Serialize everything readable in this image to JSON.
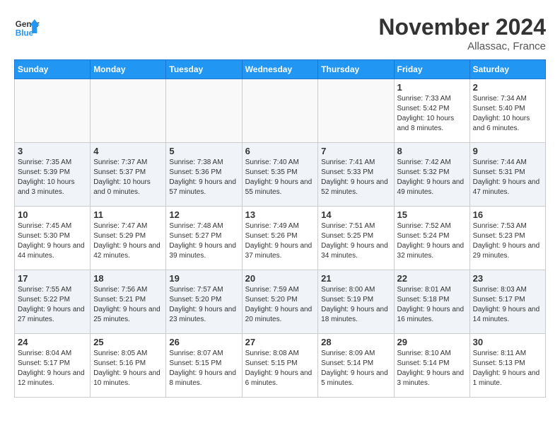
{
  "logo": {
    "text_general": "General",
    "text_blue": "Blue"
  },
  "title": "November 2024",
  "location": "Allassac, France",
  "days_of_week": [
    "Sunday",
    "Monday",
    "Tuesday",
    "Wednesday",
    "Thursday",
    "Friday",
    "Saturday"
  ],
  "weeks": [
    [
      {
        "day": "",
        "empty": true
      },
      {
        "day": "",
        "empty": true
      },
      {
        "day": "",
        "empty": true
      },
      {
        "day": "",
        "empty": true
      },
      {
        "day": "",
        "empty": true
      },
      {
        "day": "1",
        "sunrise": "Sunrise: 7:33 AM",
        "sunset": "Sunset: 5:42 PM",
        "daylight": "Daylight: 10 hours and 8 minutes."
      },
      {
        "day": "2",
        "sunrise": "Sunrise: 7:34 AM",
        "sunset": "Sunset: 5:40 PM",
        "daylight": "Daylight: 10 hours and 6 minutes."
      }
    ],
    [
      {
        "day": "3",
        "sunrise": "Sunrise: 7:35 AM",
        "sunset": "Sunset: 5:39 PM",
        "daylight": "Daylight: 10 hours and 3 minutes."
      },
      {
        "day": "4",
        "sunrise": "Sunrise: 7:37 AM",
        "sunset": "Sunset: 5:37 PM",
        "daylight": "Daylight: 10 hours and 0 minutes."
      },
      {
        "day": "5",
        "sunrise": "Sunrise: 7:38 AM",
        "sunset": "Sunset: 5:36 PM",
        "daylight": "Daylight: 9 hours and 57 minutes."
      },
      {
        "day": "6",
        "sunrise": "Sunrise: 7:40 AM",
        "sunset": "Sunset: 5:35 PM",
        "daylight": "Daylight: 9 hours and 55 minutes."
      },
      {
        "day": "7",
        "sunrise": "Sunrise: 7:41 AM",
        "sunset": "Sunset: 5:33 PM",
        "daylight": "Daylight: 9 hours and 52 minutes."
      },
      {
        "day": "8",
        "sunrise": "Sunrise: 7:42 AM",
        "sunset": "Sunset: 5:32 PM",
        "daylight": "Daylight: 9 hours and 49 minutes."
      },
      {
        "day": "9",
        "sunrise": "Sunrise: 7:44 AM",
        "sunset": "Sunset: 5:31 PM",
        "daylight": "Daylight: 9 hours and 47 minutes."
      }
    ],
    [
      {
        "day": "10",
        "sunrise": "Sunrise: 7:45 AM",
        "sunset": "Sunset: 5:30 PM",
        "daylight": "Daylight: 9 hours and 44 minutes."
      },
      {
        "day": "11",
        "sunrise": "Sunrise: 7:47 AM",
        "sunset": "Sunset: 5:29 PM",
        "daylight": "Daylight: 9 hours and 42 minutes."
      },
      {
        "day": "12",
        "sunrise": "Sunrise: 7:48 AM",
        "sunset": "Sunset: 5:27 PM",
        "daylight": "Daylight: 9 hours and 39 minutes."
      },
      {
        "day": "13",
        "sunrise": "Sunrise: 7:49 AM",
        "sunset": "Sunset: 5:26 PM",
        "daylight": "Daylight: 9 hours and 37 minutes."
      },
      {
        "day": "14",
        "sunrise": "Sunrise: 7:51 AM",
        "sunset": "Sunset: 5:25 PM",
        "daylight": "Daylight: 9 hours and 34 minutes."
      },
      {
        "day": "15",
        "sunrise": "Sunrise: 7:52 AM",
        "sunset": "Sunset: 5:24 PM",
        "daylight": "Daylight: 9 hours and 32 minutes."
      },
      {
        "day": "16",
        "sunrise": "Sunrise: 7:53 AM",
        "sunset": "Sunset: 5:23 PM",
        "daylight": "Daylight: 9 hours and 29 minutes."
      }
    ],
    [
      {
        "day": "17",
        "sunrise": "Sunrise: 7:55 AM",
        "sunset": "Sunset: 5:22 PM",
        "daylight": "Daylight: 9 hours and 27 minutes."
      },
      {
        "day": "18",
        "sunrise": "Sunrise: 7:56 AM",
        "sunset": "Sunset: 5:21 PM",
        "daylight": "Daylight: 9 hours and 25 minutes."
      },
      {
        "day": "19",
        "sunrise": "Sunrise: 7:57 AM",
        "sunset": "Sunset: 5:20 PM",
        "daylight": "Daylight: 9 hours and 23 minutes."
      },
      {
        "day": "20",
        "sunrise": "Sunrise: 7:59 AM",
        "sunset": "Sunset: 5:20 PM",
        "daylight": "Daylight: 9 hours and 20 minutes."
      },
      {
        "day": "21",
        "sunrise": "Sunrise: 8:00 AM",
        "sunset": "Sunset: 5:19 PM",
        "daylight": "Daylight: 9 hours and 18 minutes."
      },
      {
        "day": "22",
        "sunrise": "Sunrise: 8:01 AM",
        "sunset": "Sunset: 5:18 PM",
        "daylight": "Daylight: 9 hours and 16 minutes."
      },
      {
        "day": "23",
        "sunrise": "Sunrise: 8:03 AM",
        "sunset": "Sunset: 5:17 PM",
        "daylight": "Daylight: 9 hours and 14 minutes."
      }
    ],
    [
      {
        "day": "24",
        "sunrise": "Sunrise: 8:04 AM",
        "sunset": "Sunset: 5:17 PM",
        "daylight": "Daylight: 9 hours and 12 minutes."
      },
      {
        "day": "25",
        "sunrise": "Sunrise: 8:05 AM",
        "sunset": "Sunset: 5:16 PM",
        "daylight": "Daylight: 9 hours and 10 minutes."
      },
      {
        "day": "26",
        "sunrise": "Sunrise: 8:07 AM",
        "sunset": "Sunset: 5:15 PM",
        "daylight": "Daylight: 9 hours and 8 minutes."
      },
      {
        "day": "27",
        "sunrise": "Sunrise: 8:08 AM",
        "sunset": "Sunset: 5:15 PM",
        "daylight": "Daylight: 9 hours and 6 minutes."
      },
      {
        "day": "28",
        "sunrise": "Sunrise: 8:09 AM",
        "sunset": "Sunset: 5:14 PM",
        "daylight": "Daylight: 9 hours and 5 minutes."
      },
      {
        "day": "29",
        "sunrise": "Sunrise: 8:10 AM",
        "sunset": "Sunset: 5:14 PM",
        "daylight": "Daylight: 9 hours and 3 minutes."
      },
      {
        "day": "30",
        "sunrise": "Sunrise: 8:11 AM",
        "sunset": "Sunset: 5:13 PM",
        "daylight": "Daylight: 9 hours and 1 minute."
      }
    ]
  ]
}
